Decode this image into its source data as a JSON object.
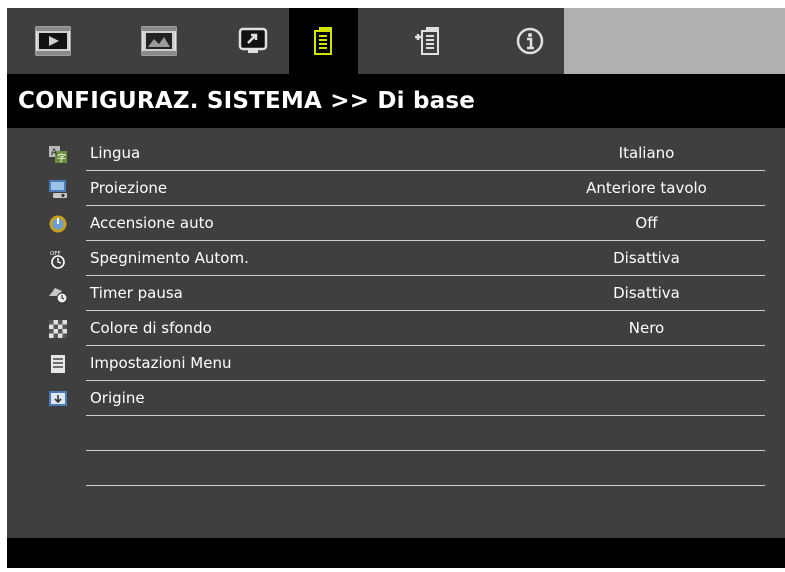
{
  "tabs": [
    {
      "icon": "image-icon"
    },
    {
      "icon": "display-icon"
    },
    {
      "icon": "setup-icon"
    },
    {
      "icon": "system-config-icon"
    },
    {
      "icon": "advanced-settings-icon"
    },
    {
      "icon": "info-icon"
    }
  ],
  "active_tab": 3,
  "title": "CONFIGURAZ. SISTEMA >> Di base",
  "rows": [
    {
      "icon": "language-icon",
      "label": "Lingua",
      "value": "Italiano"
    },
    {
      "icon": "projection-icon",
      "label": "Proiezione",
      "value": "Anteriore tavolo"
    },
    {
      "icon": "power-on-icon",
      "label": "Accensione auto",
      "value": "Off"
    },
    {
      "icon": "auto-off-icon",
      "label": "Spegnimento Autom.",
      "value": "Disattiva"
    },
    {
      "icon": "sleep-timer-icon",
      "label": "Timer pausa",
      "value": "Disattiva"
    },
    {
      "icon": "background-color-icon",
      "label": "Colore di sfondo",
      "value": "Nero"
    },
    {
      "icon": "menu-settings-icon",
      "label": "Impostazioni Menu",
      "value": ""
    },
    {
      "icon": "source-icon",
      "label": "Origine",
      "value": ""
    },
    {
      "icon": "",
      "label": "",
      "value": ""
    },
    {
      "icon": "",
      "label": "",
      "value": ""
    }
  ],
  "colors": {
    "accent": "#d4e600",
    "background": "#3f3f3f",
    "title_bg": "#000000",
    "tab_fill": "#b0b0b0"
  }
}
